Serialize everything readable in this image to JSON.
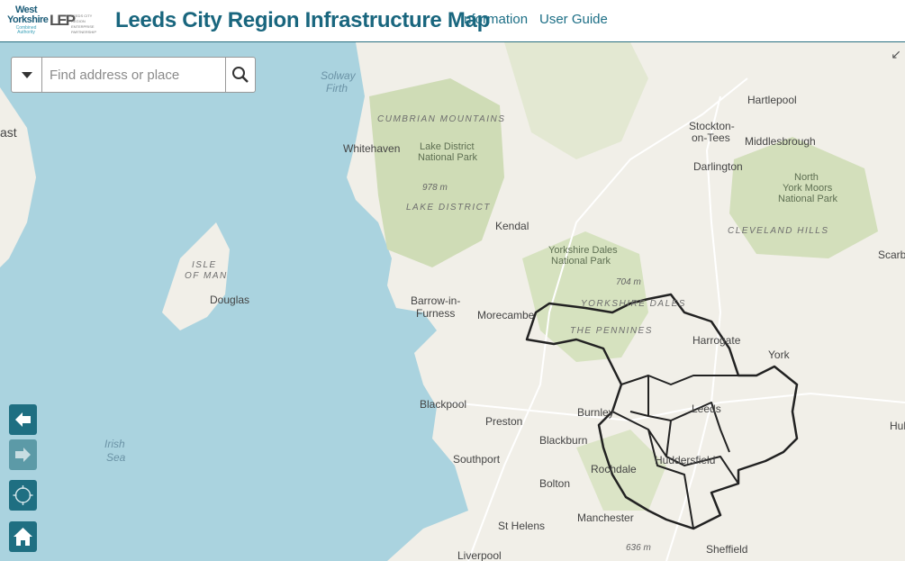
{
  "header": {
    "title": "Leeds City Region Infrastructure Map",
    "nav": [
      "Information",
      "User Guide"
    ],
    "logo_wy_main": "West Yorkshire",
    "logo_wy_sub": "Combined Authority",
    "logo_lep_mark": "LEP",
    "logo_lep_text": "LEEDS CITY REGION ENTERPRISE PARTNERSHIP"
  },
  "search": {
    "placeholder": "Find address or place"
  },
  "map_controls": [
    "previous-extent-button",
    "next-extent-button",
    "locate-button",
    "home-button"
  ],
  "map_labels": {
    "places": {
      "hartlepool": "Hartlepool",
      "stockton": "Stockton-",
      "on_tees": "on-Tees",
      "middlesbrough": "Middlesbrough",
      "darlington": "Darlington",
      "whitehaven": "Whitehaven",
      "kendal": "Kendal",
      "douglas": "Douglas",
      "barrow": "Barrow-in-",
      "furness": "Furness",
      "morecambe": "Morecambe",
      "harrogate": "Harrogate",
      "york": "York",
      "blackpool": "Blackpool",
      "preston": "Preston",
      "burnley": "Burnley",
      "leeds": "Leeds",
      "blackburn": "Blackburn",
      "southport": "Southport",
      "rochdale": "Rochdale",
      "huddersfield": "Huddersfield",
      "bolton": "Bolton",
      "manchester": "Manchester",
      "st_helens": "St Helens",
      "sheffield": "Sheffield",
      "liverpool": "Liverpool",
      "scarb": "Scarb",
      "hul": "Hul",
      "ast": "ast"
    },
    "water": {
      "solway": "Solway",
      "firth": "Firth",
      "irish": "Irish",
      "sea": "Sea"
    },
    "regions": {
      "cumbrian": "CUMBRIAN MOUNTAINS",
      "lake_district": "LAKE DISTRICT",
      "cleveland": "CLEVELAND HILLS",
      "isle1": "ISLE",
      "isle2": "OF MAN",
      "yorkshire_dales": "YORKSHIRE DALES",
      "pennines": "THE PENNINES"
    },
    "parks": {
      "lake1": "Lake District",
      "lake2": "National Park",
      "nym1": "North",
      "nym2": "York Moors",
      "nym3": "National Park",
      "ydnp1": "Yorkshire Dales",
      "ydnp2": "National Park"
    },
    "elevations": {
      "e978": "978 m",
      "e704": "704 m",
      "e636": "636 m"
    }
  },
  "colors": {
    "brand": "#19667e",
    "water": "#aad3df",
    "land": "#f1efe8",
    "upland": "#cfdcb6",
    "boundary": "#222222"
  }
}
